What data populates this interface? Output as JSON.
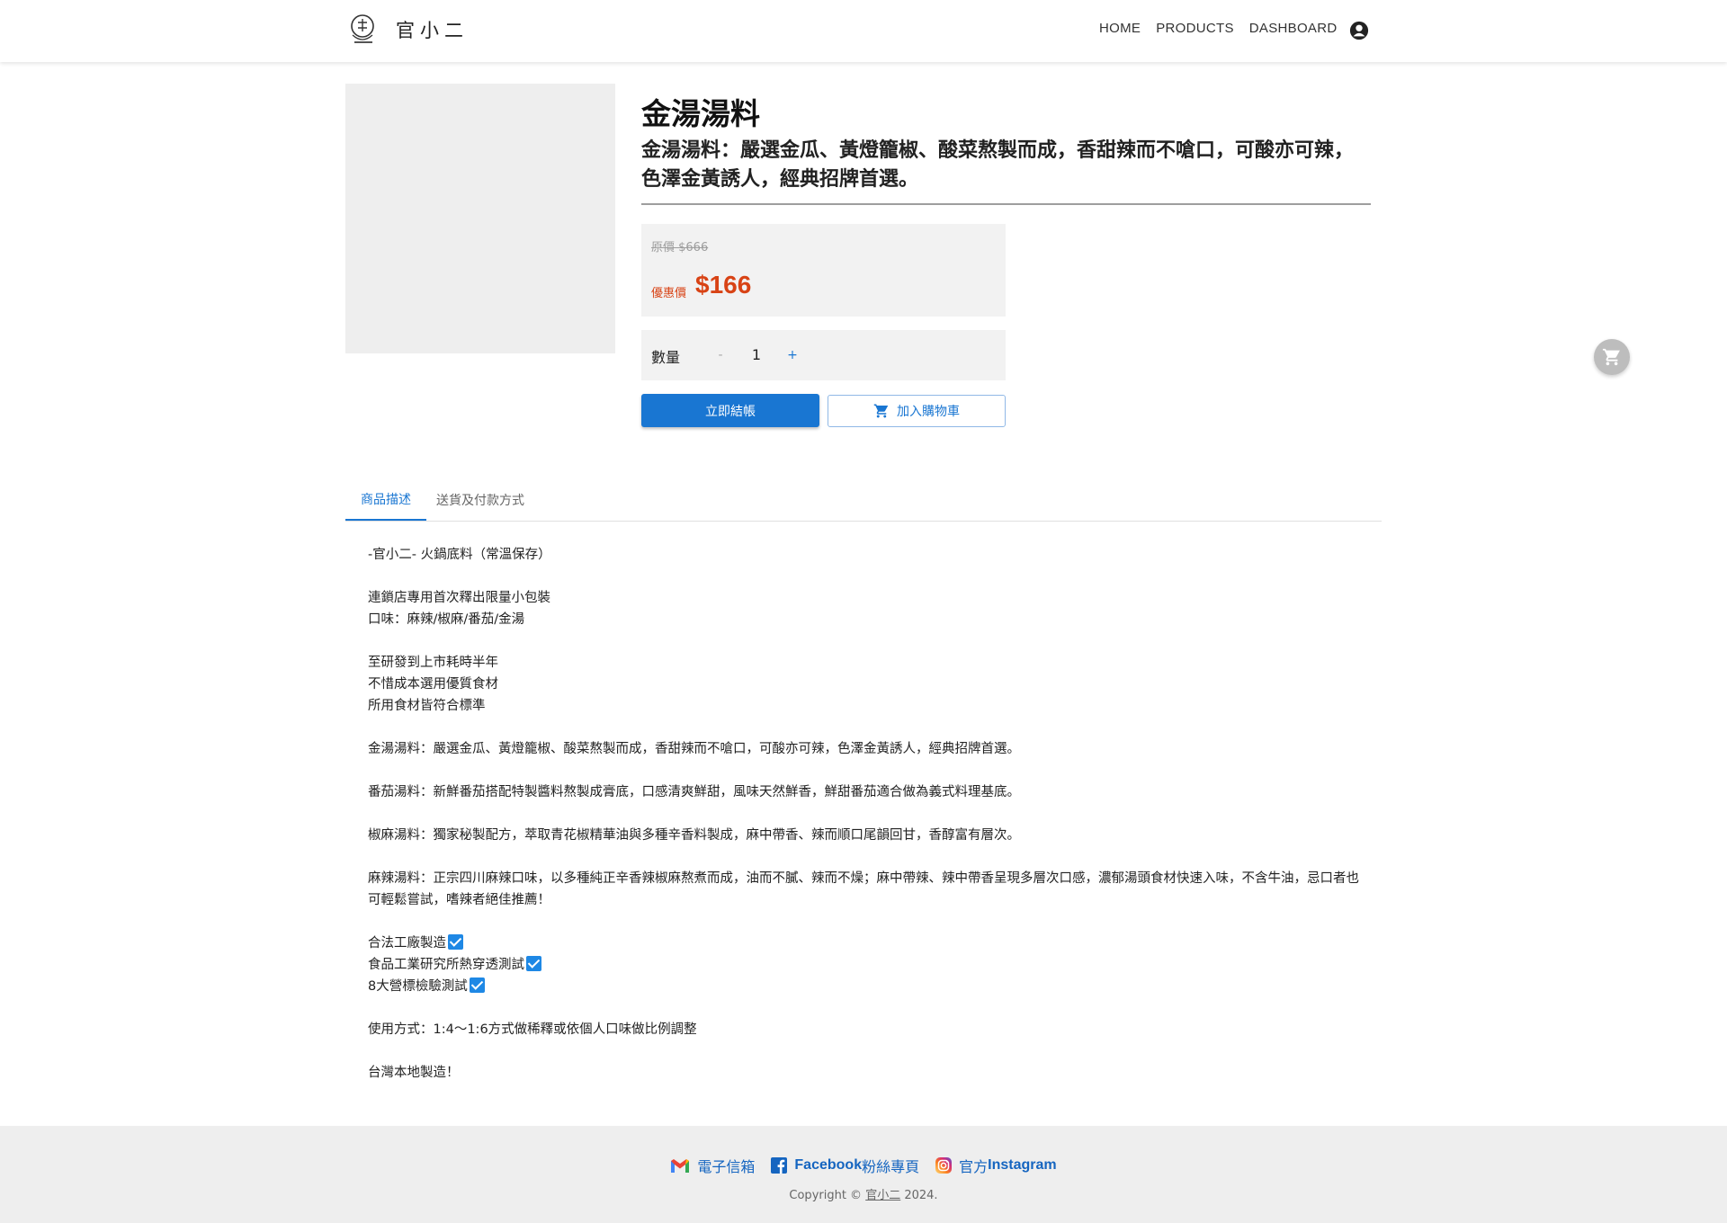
{
  "header": {
    "brand": "官小二",
    "nav": [
      "HOME",
      "PRODUCTS",
      "DASHBOARD"
    ]
  },
  "product": {
    "title": "金湯湯料",
    "subtitle": "金湯湯料：嚴選金瓜、黃燈籠椒、酸菜熬製而成，香甜辣而不嗆口，可酸亦可辣，色澤金黃誘人，經典招牌首選。",
    "original_price": "原價 $666",
    "sale_label": "優惠價",
    "sale_price": "$166",
    "quantity_label": "數量",
    "quantity_minus": "-",
    "quantity_value": "1",
    "quantity_plus": "+",
    "checkout_label": "立即結帳",
    "add_to_cart_label": "加入購物車"
  },
  "tabs": [
    "商品描述",
    "送貨及付款方式"
  ],
  "description": [
    "-官小二- 火鍋底料（常溫保存）",
    "",
    "連鎖店專用首次釋出限量小包裝",
    "口味：麻辣/椒麻/番茄/金湯",
    "",
    "至研發到上市耗時半年",
    "不惜成本選用優質食材",
    "所用食材皆符合標準",
    "",
    "金湯湯料：嚴選金瓜、黃燈籠椒、酸菜熬製而成，香甜辣而不嗆口，可酸亦可辣，色澤金黃誘人，經典招牌首選。",
    "",
    "番茄湯料：新鮮番茄搭配特製醬料熬製成膏底，口感清爽鮮甜，風味天然鮮香，鮮甜番茄適合做為義式料理基底。",
    "",
    "椒麻湯料：獨家秘製配方，萃取青花椒精華油與多種辛香料製成，麻中帶香、辣而順口尾韻回甘，香醇富有層次。",
    "",
    "麻辣湯料：正宗四川麻辣口味，以多種純正辛香辣椒麻熬煮而成，油而不膩、辣而不燥；麻中帶辣、辣中帶香呈現多層次口感，濃郁湯頭食材快速入味，不含牛油，忌口者也可輕鬆嘗試，嗜辣者絕佳推薦！",
    "",
    "合法工廠製造",
    "食品工業研究所熱穿透測試",
    "8大營標檢驗測試",
    "",
    "使用方式：1:4～1:6方式做稀釋或依個人口味做比例調整",
    "",
    "台灣本地製造！"
  ],
  "checked_lines": [
    17,
    18,
    19
  ],
  "footer": {
    "email_label": "電子信箱",
    "facebook_bold": "Facebook",
    "facebook_rest": " 粉絲專頁",
    "instagram_pre": "官方 ",
    "instagram_bold": "Instagram",
    "copyright_pre": "Copyright © ",
    "copyright_name": "官小二",
    "copyright_post": " 2024."
  },
  "icons": {
    "logo": "brand-logo-icon",
    "user": "account-circle-icon",
    "cart": "shopping-cart-icon",
    "email": "gmail-icon",
    "facebook": "facebook-icon",
    "instagram": "instagram-icon"
  },
  "colors": {
    "primary": "#1976d2",
    "sale": "#d84315",
    "panel": "#f2f2f2",
    "footer_bg": "#eeeeee"
  }
}
